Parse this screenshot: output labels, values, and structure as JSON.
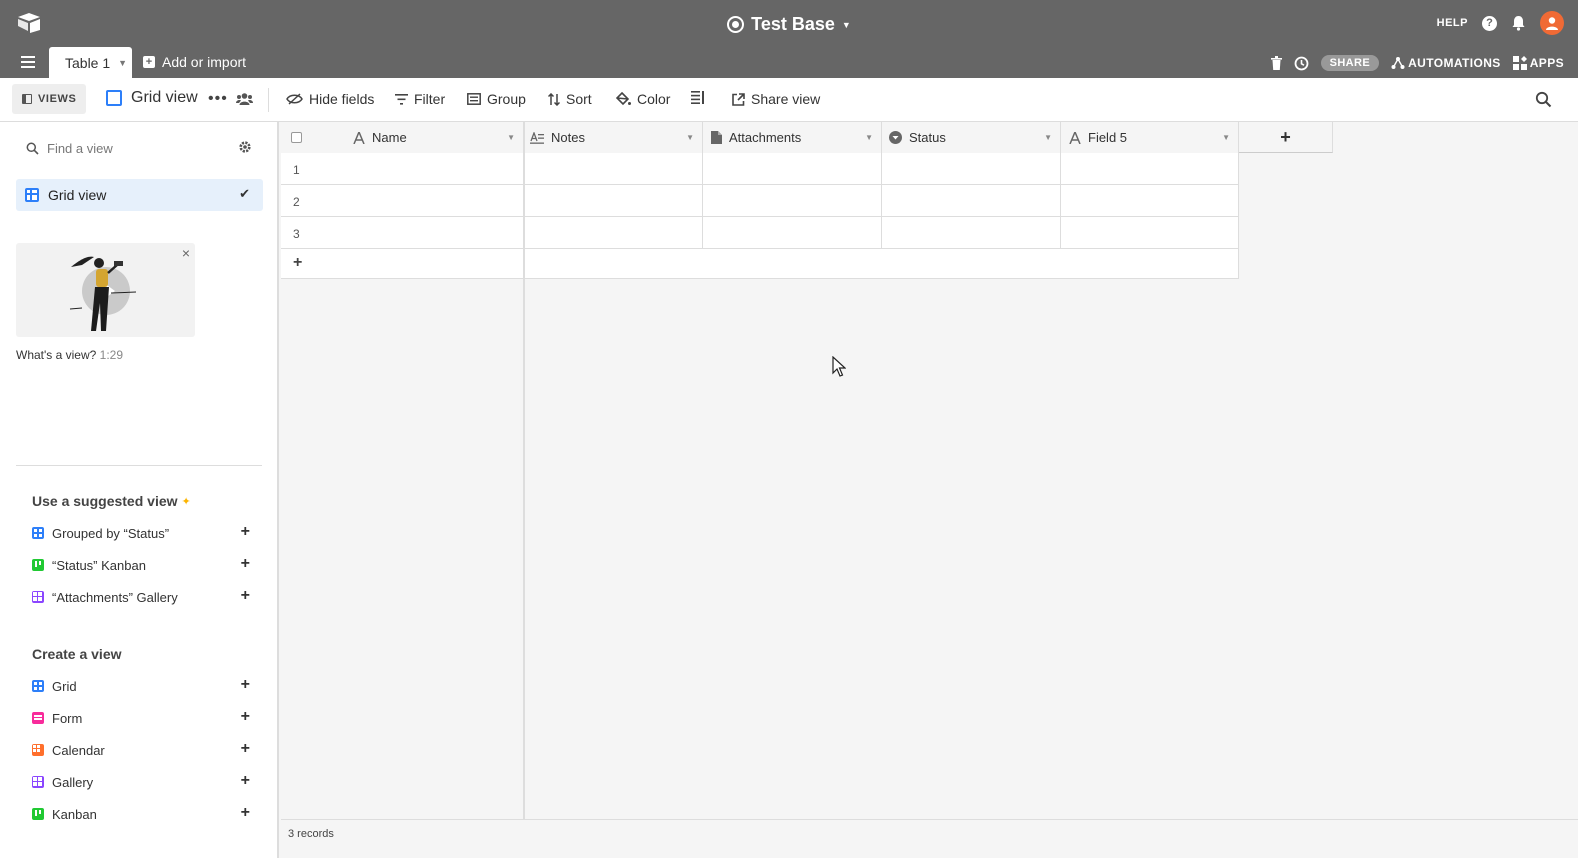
{
  "header": {
    "base_title": "Test Base",
    "help_label": "HELP",
    "help_icon": "?",
    "tab_label": "Table 1",
    "add_import_label": "Add or import",
    "share_label": "SHARE",
    "automations_label": "AUTOMATIONS",
    "apps_label": "APPS"
  },
  "viewbar": {
    "views_label": "VIEWS",
    "view_name": "Grid view",
    "hide_fields": "Hide fields",
    "filter": "Filter",
    "group": "Group",
    "sort": "Sort",
    "color": "Color",
    "share_view": "Share view"
  },
  "sidebar": {
    "find_placeholder": "Find a view",
    "active_view": "Grid view",
    "video_caption": "What's a view?",
    "video_duration": "1:29",
    "suggested_title": "Use a suggested view",
    "suggested": [
      {
        "label": "Grouped by “Status”",
        "icon": "grid-icon"
      },
      {
        "label": "“Status” Kanban",
        "icon": "kanban-icon"
      },
      {
        "label": "“Attachments” Gallery",
        "icon": "gallery-icon"
      }
    ],
    "create_title": "Create a view",
    "create": [
      {
        "label": "Grid",
        "icon": "grid-icon"
      },
      {
        "label": "Form",
        "icon": "form-icon"
      },
      {
        "label": "Calendar",
        "icon": "calendar-icon"
      },
      {
        "label": "Gallery",
        "icon": "gallery-icon"
      },
      {
        "label": "Kanban",
        "icon": "kanban-icon"
      }
    ]
  },
  "grid": {
    "columns": [
      {
        "label": "Name",
        "icon": "text-field-icon"
      },
      {
        "label": "Notes",
        "icon": "long-text-icon"
      },
      {
        "label": "Attachments",
        "icon": "attachment-icon"
      },
      {
        "label": "Status",
        "icon": "single-select-icon"
      },
      {
        "label": "Field 5",
        "icon": "text-field-icon"
      }
    ],
    "rows": [
      "1",
      "2",
      "3"
    ],
    "add_field": "+",
    "add_row": "+",
    "record_count": "3 records"
  },
  "colors": {
    "topbar": "#666666",
    "accent_blue": "#2d7ff9",
    "avatar": "#f06a35",
    "active_view_bg": "#e6f0fb"
  }
}
